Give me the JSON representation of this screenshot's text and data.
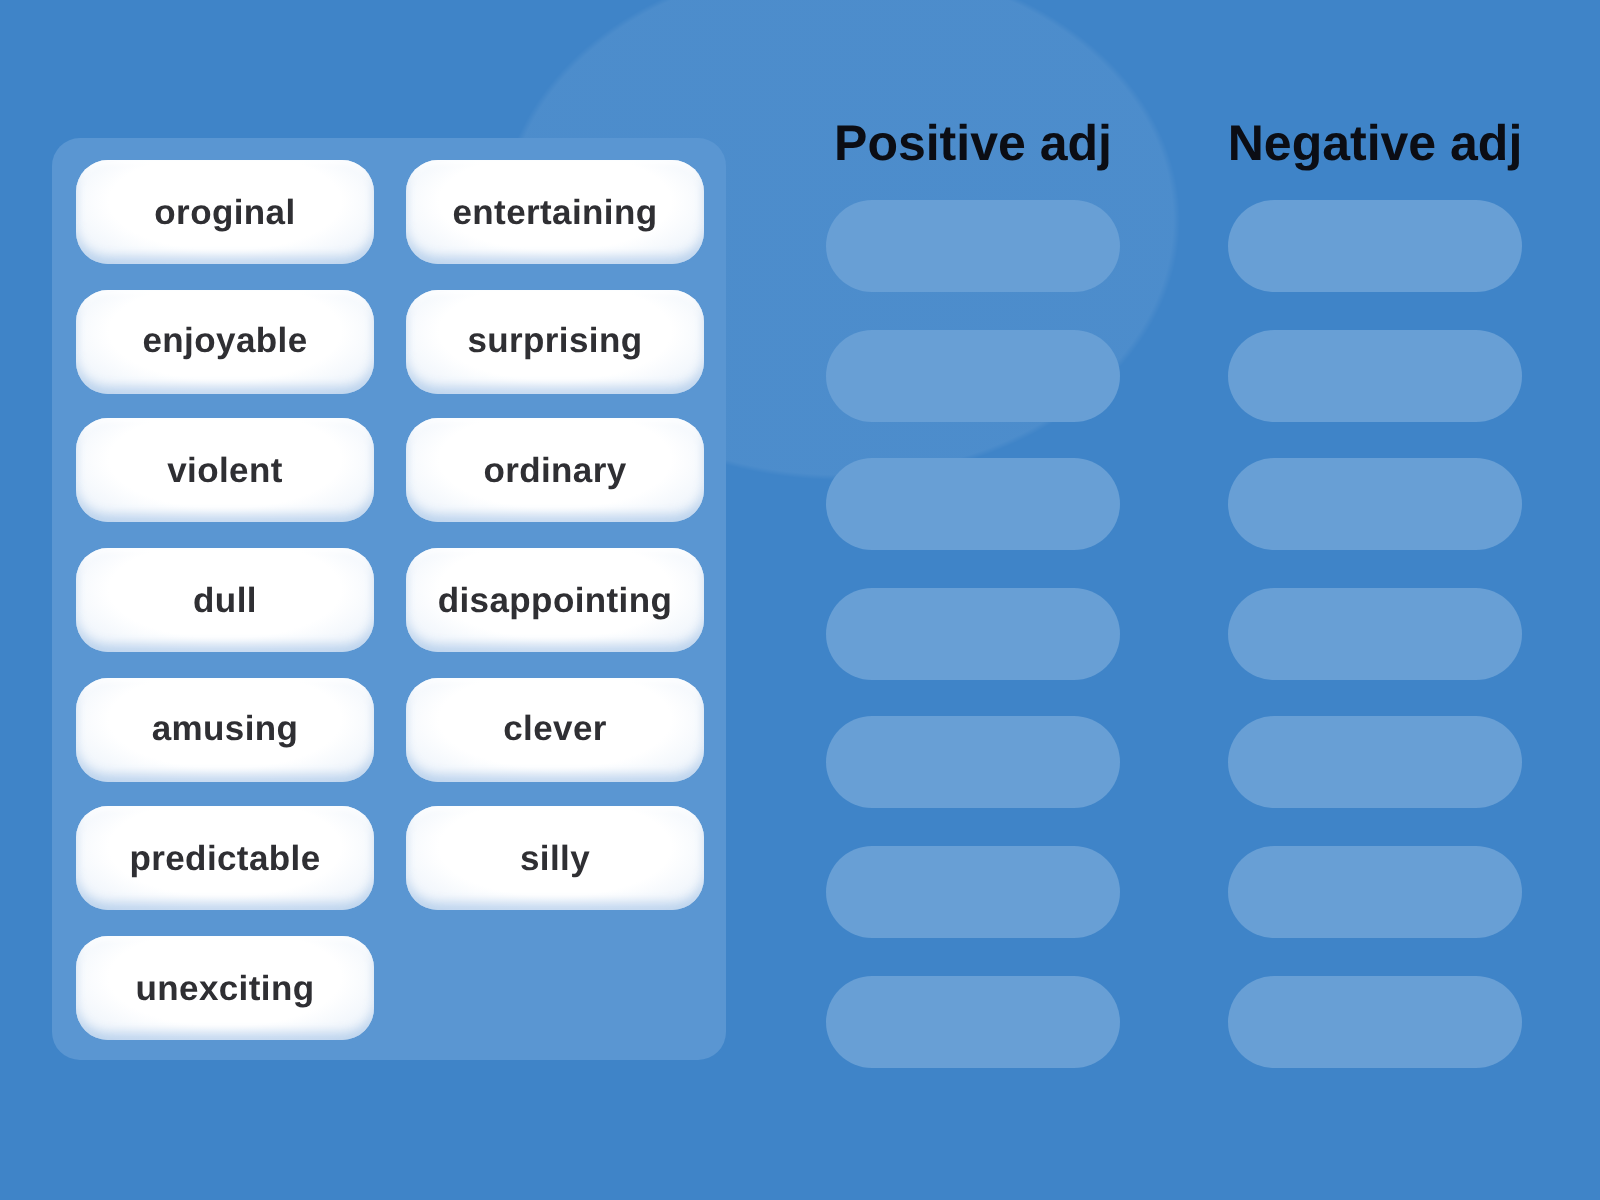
{
  "word_bank": {
    "cards": [
      "oroginal",
      "entertaining",
      "enjoyable",
      "surprising",
      "violent",
      "ordinary",
      "dull",
      "disappointing",
      "amusing",
      "clever",
      "predictable",
      "silly",
      "unexciting"
    ]
  },
  "groups": [
    {
      "heading": "Positive adj",
      "slots": [
        {
          "filled": false
        },
        {
          "filled": false
        },
        {
          "filled": false
        },
        {
          "filled": false
        },
        {
          "filled": false
        },
        {
          "filled": false
        },
        {
          "filled": false
        }
      ]
    },
    {
      "heading": "Negative adj",
      "slots": [
        {
          "filled": false
        },
        {
          "filled": false
        },
        {
          "filled": false
        },
        {
          "filled": false
        },
        {
          "filled": false
        },
        {
          "filled": false
        },
        {
          "filled": false
        }
      ]
    }
  ]
}
